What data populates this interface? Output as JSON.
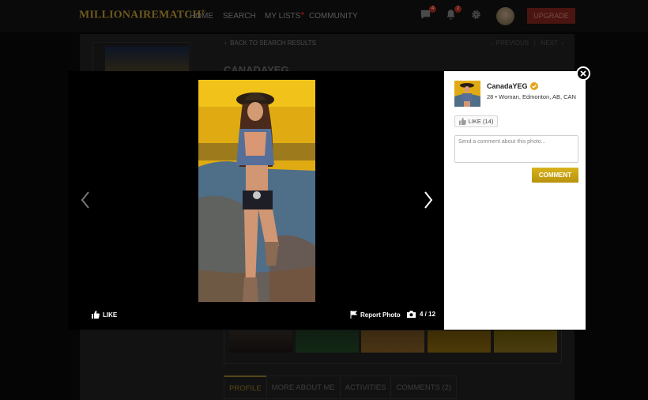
{
  "nav": {
    "logo": "MILLIONAIREMATCH",
    "logo_mark": "®",
    "links": {
      "home": "HOME",
      "search": "SEARCH",
      "my_lists": "MY LISTS",
      "community": "COMMUNITY"
    },
    "messages_badge": "4",
    "notifications_badge": "2",
    "upgrade_label": "UPGRADE"
  },
  "page": {
    "back_label": "BACK TO SEARCH RESULTS",
    "prev_label": "PREVIOUS",
    "next_label": "NEXT",
    "profile_name": "CANADAYEG",
    "tabs": [
      "PROFILE",
      "MORE ABOUT ME",
      "ACTIVITIES",
      "COMMENTS (2)"
    ]
  },
  "modal": {
    "like_label": "LIKE",
    "report_label": "Report Photo",
    "photo_counter": "4 / 12",
    "user": {
      "name": "CanadaYEG",
      "meta": "28 • Woman, Edmonton, AB, CAN"
    },
    "like_button_label": "LIKE (14)",
    "comment_placeholder": "Send a comment about this photo...",
    "comment_button": "COMMENT"
  },
  "colors": {
    "accent_gold": "#c9a417",
    "backdrop": "#050505",
    "upgrade_red": "#b52516"
  },
  "icons": [
    "chat-icon",
    "bell-icon",
    "gear-icon",
    "chevron-left-icon",
    "chevron-right-icon",
    "thumbs-up-icon",
    "flag-icon",
    "camera-icon",
    "verified-icon",
    "close-icon"
  ]
}
